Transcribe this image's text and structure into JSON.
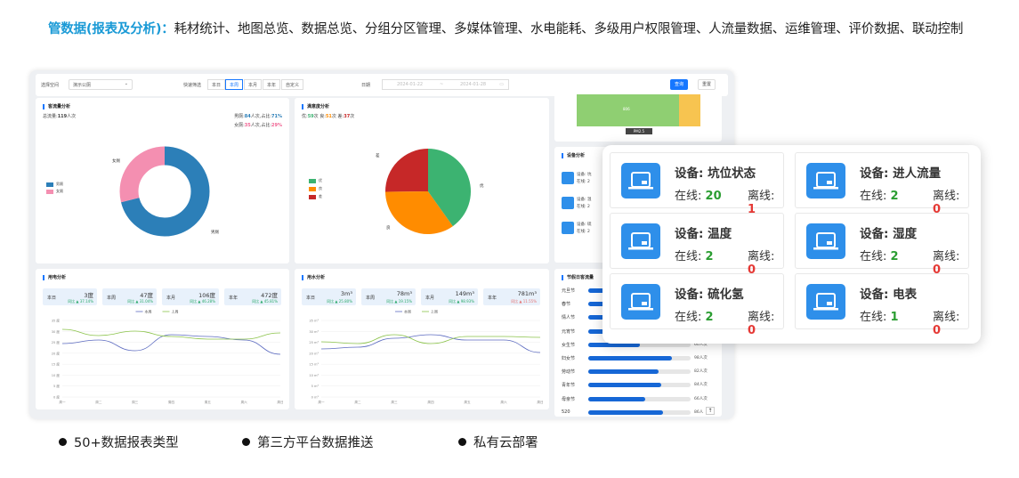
{
  "header": {
    "highlight": "管数据(报表及分析)：",
    "text": "耗材统计、地图总览、数据总览、分组分区管理、多媒体管理、水电能耗、多级用户权限管理、人流量数据、运维管理、评价数据、联动控制"
  },
  "filter": {
    "scope_label": "选择空间",
    "scope_value": "演示公厕",
    "quick_label": "快速筛选",
    "quick": [
      "本日",
      "本周",
      "本月",
      "本年",
      "自定义"
    ],
    "quick_active": "本周",
    "date_label": "日期",
    "date_start": "2024-01-22",
    "date_sep": "~",
    "date_end": "2024-01-28",
    "query": "查询",
    "reset": "重置"
  },
  "traffic": {
    "title": "客流量分析",
    "total_label": "总流量:",
    "total_value": "119",
    "total_unit": "人次",
    "male_label": "男厕:",
    "male_value": "84",
    "male_suffix": "人次,占比:",
    "male_pct": "71%",
    "female_label": "女厕:",
    "female_value": "35",
    "female_suffix": "人次,占比:",
    "female_pct": "29%",
    "legend": [
      "男厕",
      "女厕"
    ],
    "slice_labels": [
      "女厕",
      "男厕"
    ],
    "slices": [
      {
        "name": "男厕",
        "pct": 71,
        "color": "#2c7fb8"
      },
      {
        "name": "女厕",
        "pct": 29,
        "color": "#f48fb1"
      }
    ]
  },
  "satisfaction": {
    "title": "满意度分析",
    "good_label": "优:",
    "good_value": "59",
    "good_unit": "次",
    "mid_label": "良:",
    "mid_value": "51",
    "mid_unit": "次",
    "bad_label": "差:",
    "bad_value": "37",
    "bad_unit": "次",
    "legend": [
      "优",
      "良",
      "差"
    ],
    "slice_labels": [
      "优",
      "良",
      "差"
    ],
    "colors": [
      "#3cb371",
      "#ff8c00",
      "#c62828"
    ],
    "values": [
      59,
      51,
      37
    ]
  },
  "top_right": {
    "bar_label": "806",
    "tag": "PM2.5"
  },
  "device_mini": {
    "title": "设备分析",
    "lines": [
      "设备: 坑",
      "在线: 2",
      "设备: 温",
      "在线: 2",
      "设备: 硫",
      "在线: 2"
    ]
  },
  "power": {
    "title": "用电分析",
    "stats": [
      {
        "k": "本日",
        "v": "3度",
        "s": "同比 ▲ 37.14%"
      },
      {
        "k": "本周",
        "v": "47度",
        "s": "同比 ▲ 31.04%"
      },
      {
        "k": "本月",
        "v": "106度",
        "s": "同比 ▲ 46.28%"
      },
      {
        "k": "本年",
        "v": "472度",
        "s": "同比 ▲ 45.81%"
      }
    ],
    "legend": [
      "本周",
      "上周"
    ],
    "y_ticks": [
      "35 度",
      "30 度",
      "25 度",
      "20 度",
      "15 度",
      "10 度",
      "5 度",
      "0 度"
    ]
  },
  "water": {
    "title": "用水分析",
    "stats": [
      {
        "k": "本日",
        "v": "3m³",
        "s": "同比 ▲ 25.80%"
      },
      {
        "k": "本周",
        "v": "78m³",
        "s": "同比 ▲ 19.15%"
      },
      {
        "k": "本月",
        "v": "149m³",
        "s": "同比 ▲ 98.93%"
      },
      {
        "k": "本年",
        "v": "781m³",
        "s": "同比 ▲ 11.55%"
      }
    ],
    "legend": [
      "本周",
      "上周"
    ],
    "y_ticks": [
      "35 m³",
      "30 m³",
      "25 m³",
      "20 m³",
      "15 m³",
      "10 m³",
      "5 m³",
      "0 m³"
    ]
  },
  "weekdays": [
    "周一",
    "周二",
    "周三",
    "周四",
    "周五",
    "周六",
    "周日"
  ],
  "holiday": {
    "title": "节假日客流量",
    "rows": [
      {
        "name": "元旦节",
        "value": "",
        "pct": 0.3
      },
      {
        "name": "春节",
        "value": "",
        "pct": 0.3
      },
      {
        "name": "情人节",
        "value": "",
        "pct": 0.3
      },
      {
        "name": "元宵节",
        "value": "",
        "pct": 0.3
      },
      {
        "name": "女生节",
        "value": "60人次",
        "pct": 0.5
      },
      {
        "name": "妇女节",
        "value": "98人次",
        "pct": 0.82
      },
      {
        "name": "劳动节",
        "value": "82人次",
        "pct": 0.69
      },
      {
        "name": "青年节",
        "value": "84人次",
        "pct": 0.71
      },
      {
        "name": "母亲节",
        "value": "66人次",
        "pct": 0.56
      },
      {
        "name": "520",
        "value": "86人",
        "pct": 0.73
      }
    ]
  },
  "devices": [
    {
      "name": "设备: 坑位状态",
      "on_label": "在线:",
      "on": "20",
      "off_label": "离线:",
      "off": "1"
    },
    {
      "name": "设备: 进人流量",
      "on_label": "在线:",
      "on": "2",
      "off_label": "离线:",
      "off": "0"
    },
    {
      "name": "设备: 温度",
      "on_label": "在线:",
      "on": "2",
      "off_label": "离线:",
      "off": "0"
    },
    {
      "name": "设备: 湿度",
      "on_label": "在线:",
      "on": "2",
      "off_label": "离线:",
      "off": "0"
    },
    {
      "name": "设备: 硫化氢",
      "on_label": "在线:",
      "on": "2",
      "off_label": "离线:",
      "off": "0"
    },
    {
      "name": "设备: 电表",
      "on_label": "在线:",
      "on": "1",
      "off_label": "离线:",
      "off": "0"
    }
  ],
  "bullets": [
    "50+数据报表类型",
    "第三方平台数据推送",
    "私有云部署"
  ]
}
